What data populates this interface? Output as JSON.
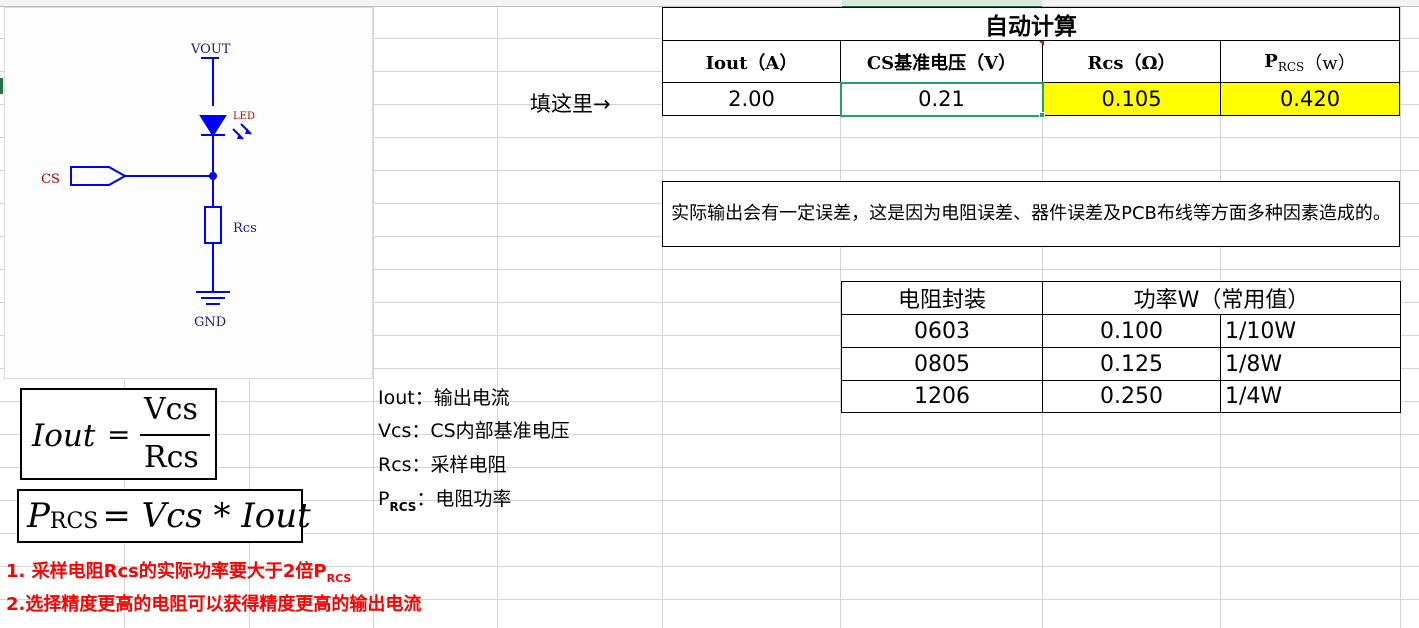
{
  "calc": {
    "title": "自动计算",
    "headers": {
      "iout": "Iout（A）",
      "cs_vref": "CS基准电压（V）",
      "rcs": "Rcs（Ω）",
      "prcs_main": "P",
      "prcs_sub": "RCS",
      "prcs_unit": "（w）"
    },
    "input_hint": "填这里→",
    "values": {
      "iout": "2.00",
      "cs_vref": "0.21",
      "rcs": "0.105",
      "prcs": "0.420"
    }
  },
  "note": {
    "text": "实际输出会有一定误差，这是因为电阻误差、器件误差及PCB布线等方面多种因素造成的。"
  },
  "power_table": {
    "headers": [
      "电阻封装",
      "功率W（常用值）"
    ],
    "rows": [
      {
        "package": "0603",
        "power": "0.100",
        "fraction": "1/10W"
      },
      {
        "package": "0805",
        "power": "0.125",
        "fraction": "1/8W"
      },
      {
        "package": "1206",
        "power": "0.250",
        "fraction": "1/4W"
      }
    ]
  },
  "schematic": {
    "vout": "VOUT",
    "led": "LED",
    "cs": "CS",
    "rcs": "Rcs",
    "gnd": "GND"
  },
  "formula1": {
    "lhs": "Iout",
    "eq": "=",
    "num": "Vcs",
    "den": "Rcs"
  },
  "formula2": {
    "p": "P",
    "sub": "RCS",
    "rest": "= Vcs * Iout"
  },
  "legend": {
    "iout": "Iout：输出电流",
    "vcs": "Vcs：CS内部基准电压",
    "rcs": "Rcs：采样电阻",
    "p_main": "P",
    "p_sub": "RCS",
    "p_rest": "：电阻功率"
  },
  "notes_red": {
    "line1_main": "1. 采样电阻Rcs的实际功率要大于2倍P",
    "line1_sub": "RCS",
    "line2": "2.选择精度更高的电阻可以获得精度更高的输出电流"
  },
  "colors": {
    "yellow": "#ffff00",
    "selected_border": "#21a366",
    "circuit_blue": "#0000ff",
    "label_red": "#c00000",
    "note_red": "#ff0000"
  }
}
